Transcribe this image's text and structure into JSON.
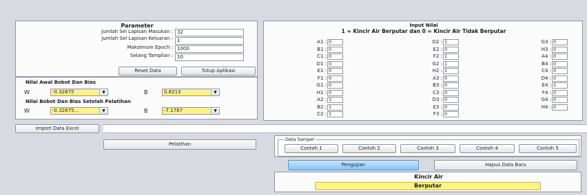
{
  "parameter": {
    "title": "Parameter",
    "fields": [
      {
        "label": "Jumlah Sel Lapisan Masukan :",
        "value": "32"
      },
      {
        "label": "Jumlah Sel Lapisan Keluaran :",
        "value": "1"
      },
      {
        "label": "Maksimum Epoch :",
        "value": "1000"
      },
      {
        "label": "Selang Tampilan :",
        "value": "10"
      }
    ],
    "reset_label": "Reset Data",
    "close_label": "Tutup Aplikasi"
  },
  "bobot": {
    "initial_title": "Nilai Awal Bobot Dan Bias",
    "initial_w_label": "W",
    "initial_w_value": "-0.32675",
    "initial_b_label": "B",
    "initial_b_value": "0.8213",
    "trained_title": "Nilai Bobot Dan Bias Setelah Pelatihan",
    "trained_w_label": "W",
    "trained_w_value": "-0.32675...",
    "trained_b_label": "B",
    "trained_b_value": "-7.1787",
    "arrow_glyph": "▼"
  },
  "import_label": "Import Data Excel",
  "train_label": "Pelatihan",
  "input_nilai": {
    "title": "Input Nilai",
    "subtitle": "1 = Kincir Air Berputar  dan 0 = Kincir Air Tidak Berputar",
    "columns": [
      [
        {
          "k": "A1 :",
          "v": "0"
        },
        {
          "k": "B1 :",
          "v": "0"
        },
        {
          "k": "C1 :",
          "v": "0"
        },
        {
          "k": "D1 :",
          "v": "0"
        },
        {
          "k": "E1 :",
          "v": "0"
        },
        {
          "k": "F1 :",
          "v": "0"
        },
        {
          "k": "G1 :",
          "v": "0"
        },
        {
          "k": "H1 :",
          "v": "0"
        },
        {
          "k": "A2 :",
          "v": "1"
        },
        {
          "k": "B2 :",
          "v": "1"
        },
        {
          "k": "C2 :",
          "v": "1"
        }
      ],
      [
        {
          "k": "D2 :",
          "v": "1"
        },
        {
          "k": "E2 :",
          "v": "0"
        },
        {
          "k": "F2 :",
          "v": "1"
        },
        {
          "k": "G2 :",
          "v": "1"
        },
        {
          "k": "H2 :",
          "v": "1"
        },
        {
          "k": "A3 :",
          "v": "0"
        },
        {
          "k": "B3 :",
          "v": "0"
        },
        {
          "k": "C3 :",
          "v": "0"
        },
        {
          "k": "D3 :",
          "v": "0"
        },
        {
          "k": "E3 :",
          "v": "0"
        },
        {
          "k": "F3 :",
          "v": "0"
        }
      ],
      [
        {
          "k": "G3 :",
          "v": "0"
        },
        {
          "k": "H3 :",
          "v": "0"
        },
        {
          "k": "A4 :",
          "v": "0"
        },
        {
          "k": "B4 :",
          "v": "0"
        },
        {
          "k": "C4 :",
          "v": "0"
        },
        {
          "k": "D4 :",
          "v": "0"
        },
        {
          "k": "E4 :",
          "v": "1"
        },
        {
          "k": "F4 :",
          "v": "0"
        },
        {
          "k": "G4 :",
          "v": "0"
        },
        {
          "k": "H4 :",
          "v": "0"
        }
      ]
    ]
  },
  "sampel": {
    "caption": "Data Sampel",
    "buttons": [
      "Contoh 1",
      "Contoh 2",
      "Contoh 3",
      "Contoh 4",
      "Contoh 5"
    ]
  },
  "pengujian_label": "Pengujian",
  "hapus_label": "Hapus Data Baru",
  "result": {
    "title": "Kincir Air",
    "value": "Berputar"
  }
}
